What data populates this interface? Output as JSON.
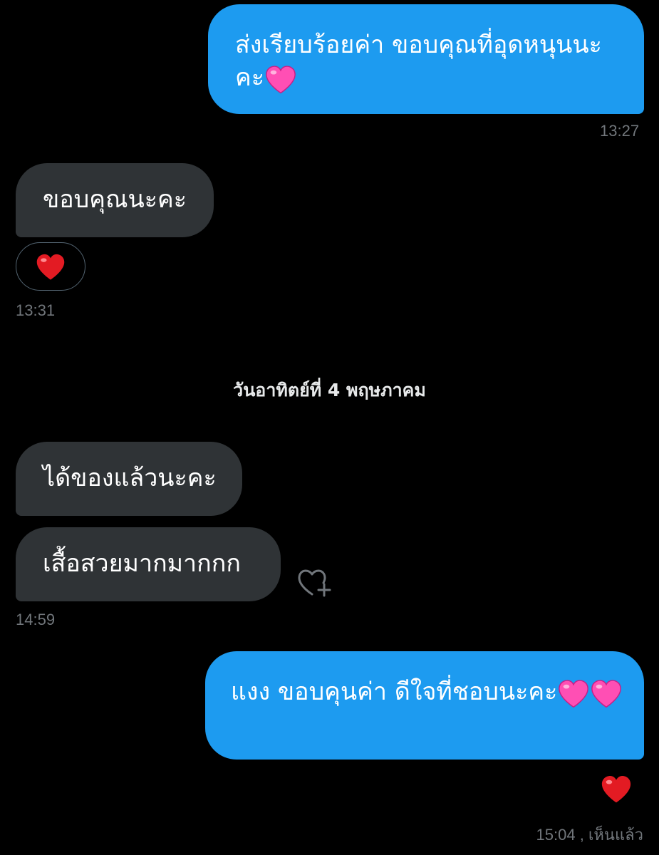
{
  "colors": {
    "background": "#000000",
    "outgoing_bubble": "#1d9bf0",
    "incoming_bubble": "#2f3336",
    "timestamp": "#71767b",
    "pink_heart": "#ff4fb4",
    "red_heart": "#e31b23"
  },
  "messages": [
    {
      "direction": "outgoing",
      "text": "ส่งเรียบร้อยค่า ขอบคุณที่อุดหนุนนะคะ",
      "emoji": "pink-heart",
      "time": "13:27"
    },
    {
      "direction": "incoming",
      "text": "ขอบคุณนะคะ",
      "reaction": "red-heart",
      "time": "13:31"
    },
    {
      "direction": "incoming",
      "text": "ได้ของแล้วนะคะ"
    },
    {
      "direction": "incoming",
      "text": "เสื้อสวยมากมากกก",
      "react_action_icon": "add-reaction-heart-icon",
      "time": "14:59"
    },
    {
      "direction": "outgoing",
      "text": "แงง ขอบคุนค่า ดีใจที่ชอบนะคะ",
      "emoji": "pink-heart ×2",
      "reaction": "red-heart",
      "time": "15:04",
      "status": ", เห็นแล้ว"
    }
  ],
  "date_separator": "วันอาทิตย์ที่ 4 พฤษภาคม"
}
